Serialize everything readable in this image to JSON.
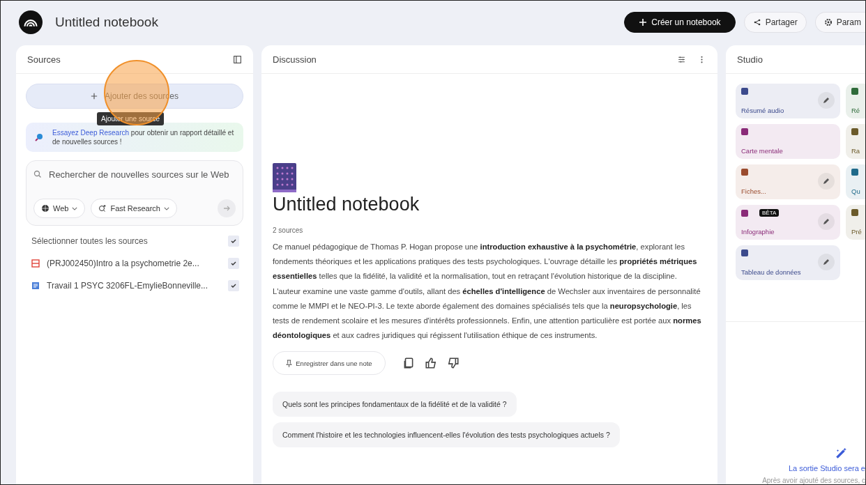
{
  "header": {
    "title": "Untitled notebook",
    "buttons": [
      {
        "kind": "primary",
        "label": "Créer un notebook"
      },
      {
        "kind": "share",
        "label": "Partager"
      },
      {
        "kind": "settings",
        "label": "Param"
      }
    ]
  },
  "sources": {
    "title": "Sources",
    "add_button": "Ajouter des sources",
    "tooltip": "Ajouter une source",
    "promo": {
      "link": "Essayez Deep Research",
      "text": " pour obtenir un rapport détaillé et de nouvelles sources !"
    },
    "search": {
      "placeholder": "Rechercher de nouvelles sources sur le Web",
      "chips": [
        "Web",
        "Fast Research"
      ]
    },
    "select_all": {
      "label": "Sélectionner toutes les sources",
      "checked": true
    },
    "items": [
      {
        "kind": "pdf",
        "label": "(PRJ002450)Intro a la psychometrie 2e...",
        "checked": true
      },
      {
        "kind": "doc",
        "label": "Travail 1 PSYC 3206FL-EmylieBonneville...",
        "checked": true
      }
    ]
  },
  "discussion": {
    "title": "Discussion",
    "notebook_title": "Untitled notebook",
    "source_count": "2 sources",
    "summary": "Ce manuel pédagogique de Thomas P. Hogan propose une **introduction exhaustive à la psychométrie**, explorant les fondements théoriques et les applications pratiques des tests psychologiques. L'ouvrage détaille les **propriétés métriques essentielles** telles que la fidélité, la validité et la normalisation, tout en retraçant l'évolution historique de la discipline. L'auteur examine une vaste gamme d'outils, allant des **échelles d'intelligence** de Wechsler aux inventaires de personnalité comme le MMPI et le NEO-PI-3. Le texte aborde également des domaines spécialisés tels que la **neuropsychologie**, les tests de rendement scolaire et les mesures d'intérêts professionnels. Enfin, une attention particulière est portée aux **normes déontologiques** et aux cadres juridiques qui régissent l'utilisation éthique de ces instruments.",
    "save_note": "Enregistrer dans une note",
    "suggestions": [
      "Quels sont les principes fondamentaux de la fidélité et de la validité ?",
      "Comment l'histoire et les technologies influencent-elles l'évolution des tests psychologiques actuels ?"
    ]
  },
  "studio": {
    "title": "Studio",
    "cards": [
      {
        "label": "Résumé audio",
        "color": "#3c4a8c",
        "editable": true
      },
      {
        "label": "Ré",
        "color": "#2f6b3a",
        "editable": false
      },
      {
        "label": "Carte mentale",
        "color": "#8a2b78",
        "editable": false
      },
      {
        "label": "Ra",
        "color": "#6b5a2a",
        "editable": false
      },
      {
        "label": "Fiches...",
        "color": "#9a4b2e",
        "editable": true
      },
      {
        "label": "Qu",
        "color": "#1f6a8a",
        "editable": false
      },
      {
        "label": "Infographie",
        "color": "#8a2b78",
        "editable": true,
        "badge": "BÊTA"
      },
      {
        "label": "Pré",
        "color": "#6b5a2a",
        "editable": false
      },
      {
        "label": "Tableau de données",
        "color": "#3c4a8c",
        "editable": true
      }
    ],
    "empty_title": "La sortie Studio sera e",
    "empty_text": "Après avoir ajouté des sources, c"
  }
}
